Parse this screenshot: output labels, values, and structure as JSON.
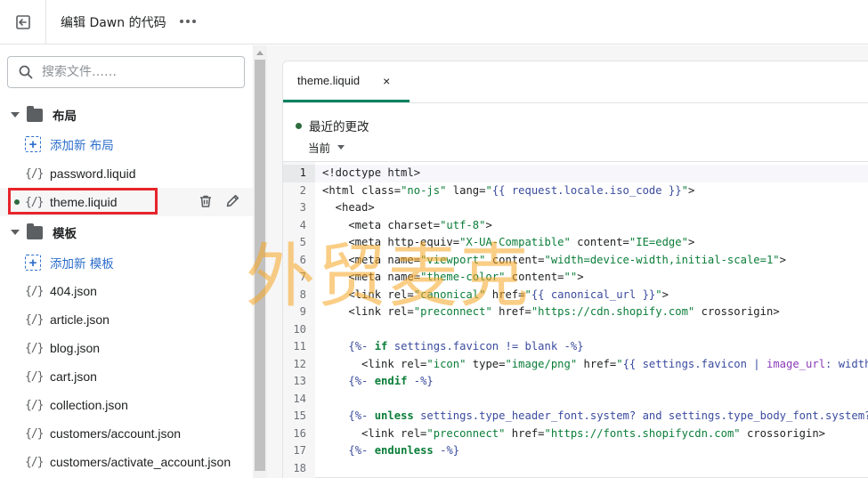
{
  "topbar": {
    "title": "编辑 Dawn 的代码",
    "exit_icon": "exit-icon",
    "more_icon": "more-horizontal-icon"
  },
  "search": {
    "placeholder": "搜索文件……",
    "icon": "search-icon"
  },
  "sections": {
    "layout": {
      "label": "布局",
      "add_label": "添加新 布局",
      "files": [
        "password.liquid",
        "theme.liquid"
      ],
      "selected": "theme.liquid"
    },
    "templates": {
      "label": "模板",
      "add_label": "添加新 模板",
      "files": [
        "404.json",
        "article.json",
        "blog.json",
        "cart.json",
        "collection.json",
        "customers/account.json",
        "customers/activate_account.json"
      ]
    }
  },
  "file_icon_glyph": "{/}",
  "editor": {
    "tab": {
      "label": "theme.liquid",
      "close": "×"
    },
    "recent_changes": "最近的更改",
    "version": "当前",
    "active_line": 1,
    "line_numbers": [
      "1",
      "2",
      "3",
      "4",
      "5",
      "6",
      "7",
      "8",
      "9",
      "10",
      "11",
      "12",
      "13",
      "14",
      "15",
      "16",
      "17",
      "18"
    ]
  },
  "watermark": "外贸麦克",
  "colors": {
    "accent_green": "#008060",
    "link_blue": "#2c6ecb",
    "highlight_red": "#e8242b",
    "watermark_orange": "#f5a623"
  }
}
